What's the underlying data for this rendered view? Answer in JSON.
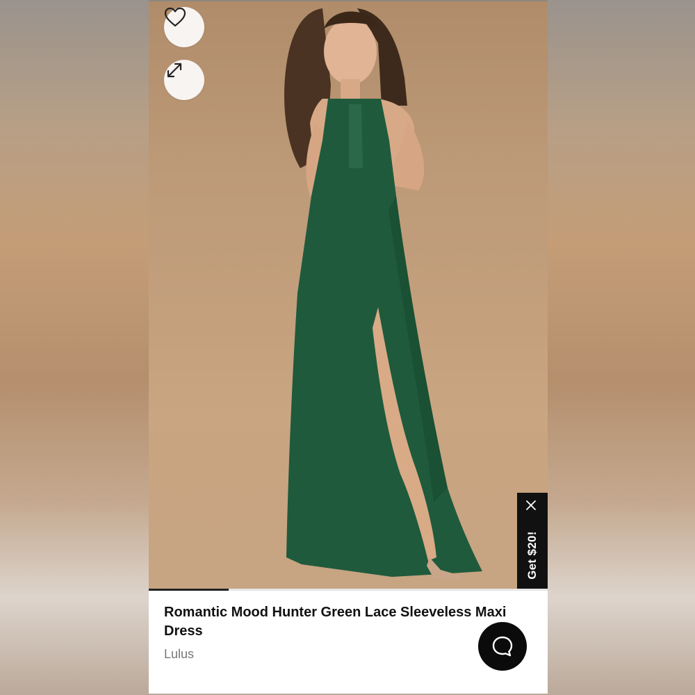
{
  "product": {
    "title": "Romantic Mood Hunter Green Lace Sleeveless Maxi Dress",
    "brand": "Lulus"
  },
  "promo": {
    "label": "Get $20!"
  },
  "carousel": {
    "progress": 0.2
  },
  "icons": {
    "like": "heart-icon",
    "expand": "expand-arrows-icon",
    "promo_close": "close-icon",
    "chat": "chat-bubble-icon"
  },
  "colors": {
    "dress": "#1f5a3c",
    "backdrop": "#c4a07d",
    "promo_bg": "#111111",
    "chat_bg": "#0b0b0b"
  }
}
